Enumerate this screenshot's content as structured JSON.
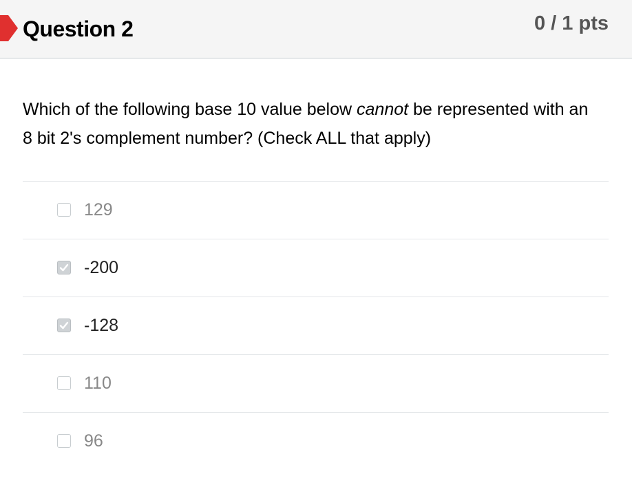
{
  "question": {
    "title": "Question 2",
    "points": "0 / 1 pts",
    "text_before": "Which of the following base 10 value below ",
    "text_emphasis": "cannot",
    "text_after": " be represented with an 8 bit 2's complement number? (Check ALL that apply)",
    "marker_color": "#e0302f"
  },
  "answers": [
    {
      "label": "129",
      "checked": false
    },
    {
      "label": "-200",
      "checked": true
    },
    {
      "label": "-128",
      "checked": true
    },
    {
      "label": "110",
      "checked": false
    },
    {
      "label": "96",
      "checked": false
    }
  ]
}
